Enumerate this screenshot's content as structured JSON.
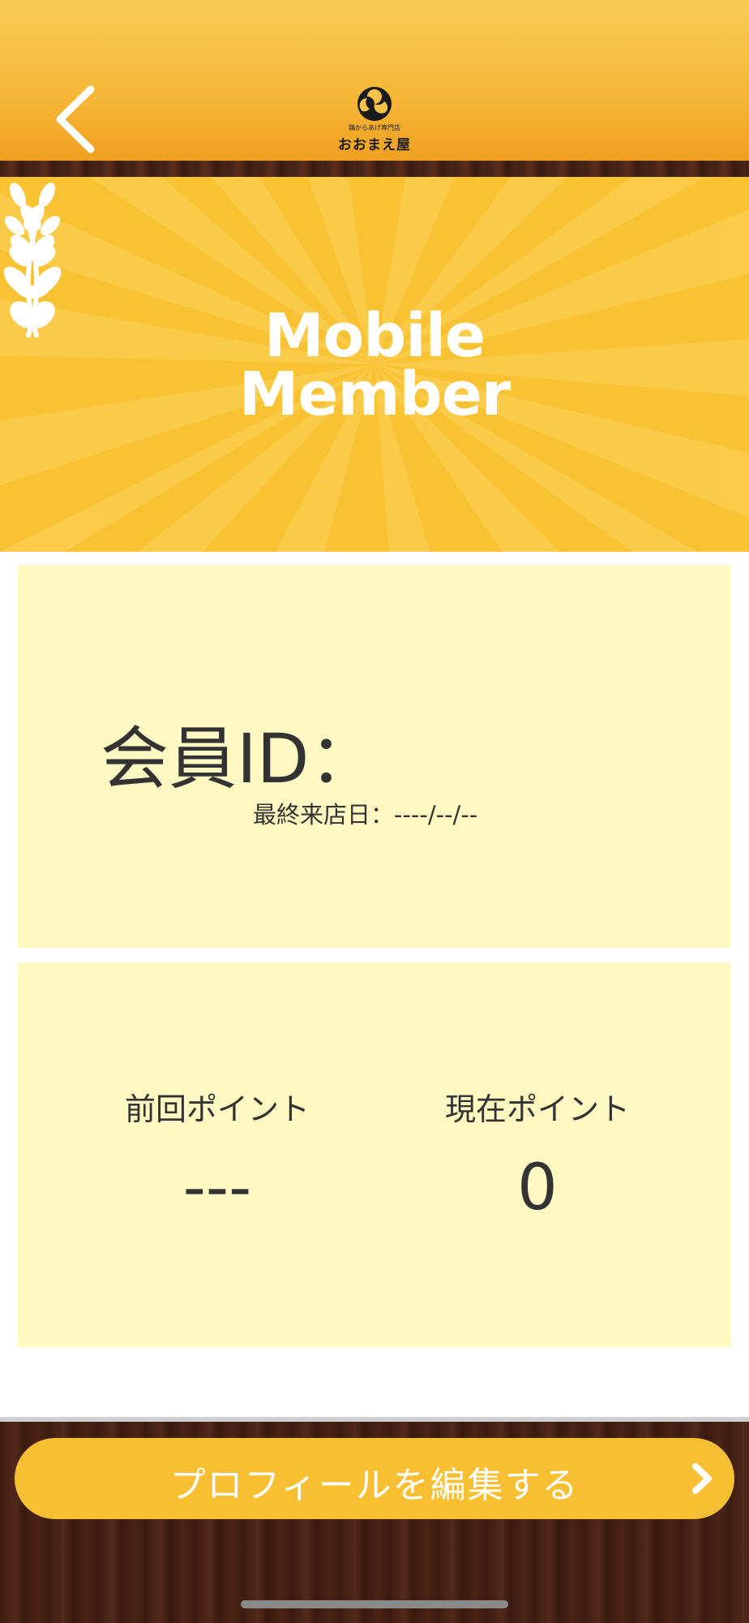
{
  "header": {
    "back_icon": "chevron-left-icon",
    "logo": {
      "icon": "tomoe-icon",
      "subtitle": "鶏からあげ専門店",
      "name": "おおまえ屋"
    }
  },
  "banner": {
    "title_line1": "Mobile",
    "title_line2": "Member",
    "decoration": "laurel-icon"
  },
  "member_card": {
    "id_label": "会員ID：",
    "last_visit": "最終来店日：----/--/--"
  },
  "points_card": {
    "previous_label": "前回ポイント",
    "previous_value": "---",
    "current_label": "現在ポイント",
    "current_value": "0"
  },
  "footer": {
    "edit_button_label": "プロフィールを編集する",
    "edit_button_icon": "chevron-right-icon"
  },
  "colors": {
    "header_orange": "#f6b93a",
    "banner_yellow": "#f9c233",
    "card_cream": "#fef8c2",
    "button_yellow": "#f9bf32",
    "wood_brown": "#4a2416"
  }
}
